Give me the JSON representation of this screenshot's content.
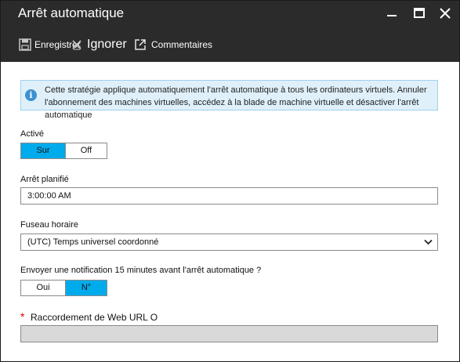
{
  "window": {
    "title": "Arrêt automatique"
  },
  "toolbar": {
    "save_label": "Enregistrer",
    "discard_label": "Ignorer",
    "feedback_label": "Commentaires"
  },
  "info": {
    "text": "Cette stratégie applique automatiquement l'arrêt automatique à tous les ordinateurs virtuels. Annuler l'abonnement des machines virtuelles, accédez à la blade de machine virtuelle et désactiver l'arrêt automatique"
  },
  "form": {
    "enabled": {
      "label": "Activé",
      "on_label": "Sur",
      "off_label": "Off",
      "selected": "on"
    },
    "scheduled_shutdown": {
      "label": "Arrêt planifié",
      "value": "3:00:00 AM"
    },
    "timezone": {
      "label": "Fuseau horaire",
      "value": "(UTC) Temps universel coordonné"
    },
    "notification": {
      "label": "Envoyer une notification 15 minutes avant l'arrêt automatique ?",
      "yes_label": "Oui",
      "no_label": "N°",
      "selected": "no"
    },
    "webhook": {
      "required_mark": "*",
      "label": "Raccordement de Web URL O",
      "value": ""
    }
  },
  "colors": {
    "titlebar": "#2b2b2b",
    "accent": "#00abec",
    "info_background": "#dff0fa",
    "info_icon": "#3d91d1",
    "required": "#e00000"
  },
  "icons": {
    "save": "floppy-disk-icon",
    "discard": "discard-x-icon",
    "feedback": "external-link-icon",
    "info": "info-icon",
    "minimize": "minimize-icon",
    "maximize": "maximize-icon",
    "close": "close-icon",
    "dropdown": "chevron-down-icon"
  }
}
